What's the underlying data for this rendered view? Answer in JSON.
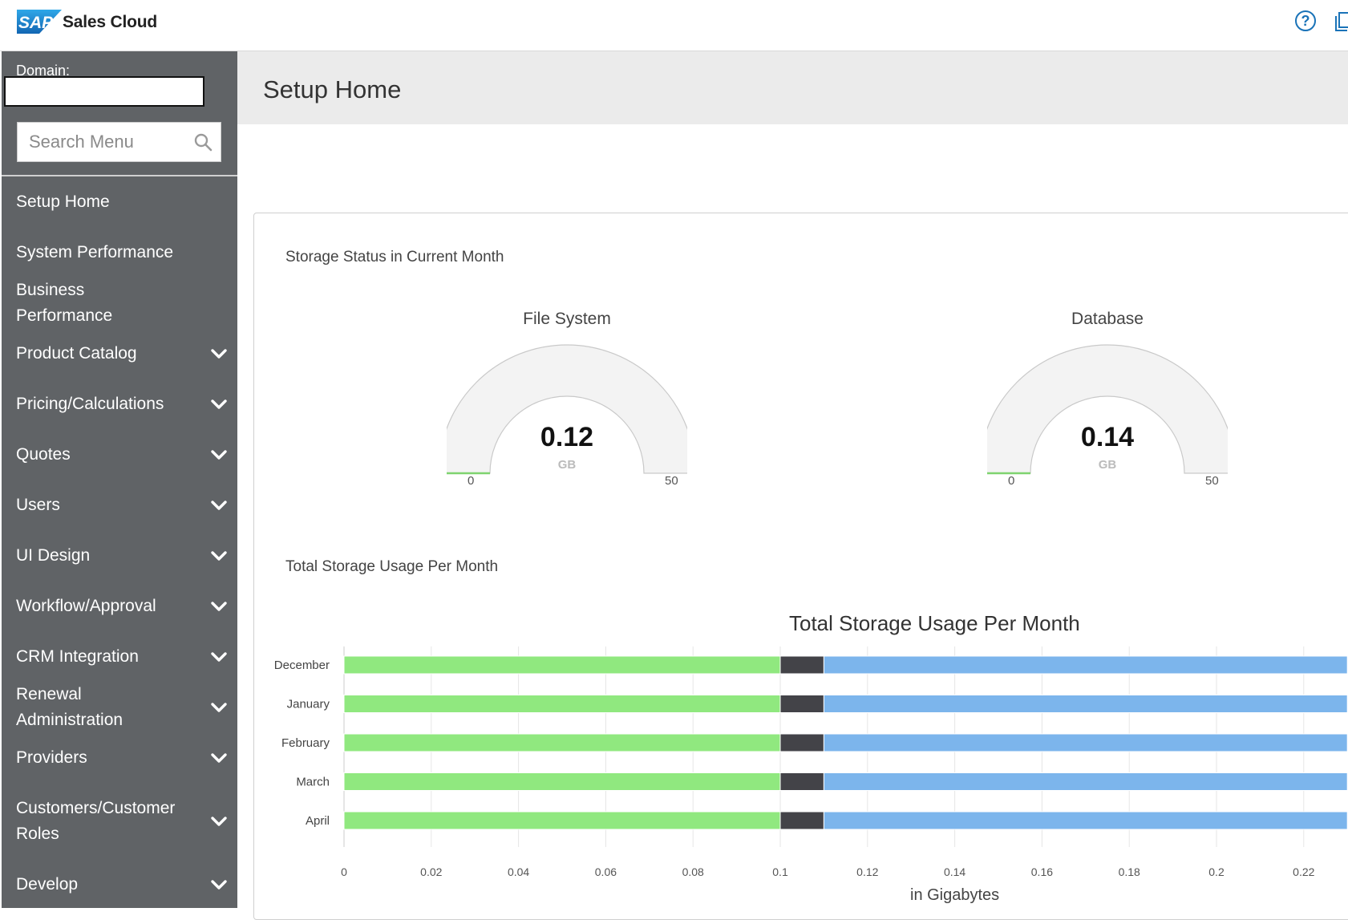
{
  "header": {
    "app_name": "Sales Cloud",
    "help_icon": "help-circle-icon",
    "copy_icon": "copy-icon"
  },
  "sidebar": {
    "domain_label": "Domain:",
    "domain_value": "",
    "search_placeholder": "Search Menu",
    "items": [
      {
        "label": "Setup Home",
        "expandable": false
      },
      {
        "label": "System Performance",
        "expandable": false
      },
      {
        "label": "Business Performance",
        "expandable": false
      },
      {
        "label": "Product Catalog",
        "expandable": true
      },
      {
        "label": "Pricing/Calculations",
        "expandable": true
      },
      {
        "label": "Quotes",
        "expandable": true
      },
      {
        "label": "Users",
        "expandable": true
      },
      {
        "label": "UI Design",
        "expandable": true
      },
      {
        "label": "Workflow/Approval",
        "expandable": true
      },
      {
        "label": "CRM Integration",
        "expandable": true
      },
      {
        "label": "Renewal Administration",
        "expandable": true
      },
      {
        "label": "Providers",
        "expandable": true
      },
      {
        "label": "Customers/Customer Roles",
        "expandable": true
      },
      {
        "label": "Develop",
        "expandable": true
      }
    ]
  },
  "main": {
    "page_title": "Setup Home",
    "storage_status_title": "Storage Status in Current Month",
    "gauges": [
      {
        "title": "File System",
        "value": "0.12",
        "unit": "GB",
        "min": "0",
        "max": "50"
      },
      {
        "title": "Database",
        "value": "0.14",
        "unit": "GB",
        "min": "0",
        "max": "50"
      }
    ],
    "usage_section_title": "Total Storage Usage Per Month"
  },
  "colors": {
    "sidebar_bg": "#606366",
    "green": "#90e87f",
    "dark": "#434348",
    "blue": "#7cb5ec"
  },
  "chart_data": {
    "type": "bar",
    "orientation": "horizontal",
    "stacked": true,
    "title": "Total Storage Usage Per Month",
    "xlabel": "in Gigabytes",
    "ylabel": "",
    "categories": [
      "December",
      "January",
      "February",
      "March",
      "April"
    ],
    "series": [
      {
        "values": [
          0.1,
          0.1,
          0.1,
          0.1,
          0.1
        ],
        "color": "#90e87f"
      },
      {
        "values": [
          0.01,
          0.01,
          0.01,
          0.01,
          0.01
        ],
        "color": "#434348"
      },
      {
        "values": [
          0.12,
          0.12,
          0.12,
          0.12,
          0.12
        ],
        "color": "#7cb5ec"
      }
    ],
    "xticks": [
      "0",
      "0.02",
      "0.04",
      "0.06",
      "0.08",
      "0.1",
      "0.12",
      "0.14",
      "0.16",
      "0.18",
      "0.2",
      "0.22"
    ],
    "xlim": [
      0,
      0.22
    ],
    "grid": true
  }
}
